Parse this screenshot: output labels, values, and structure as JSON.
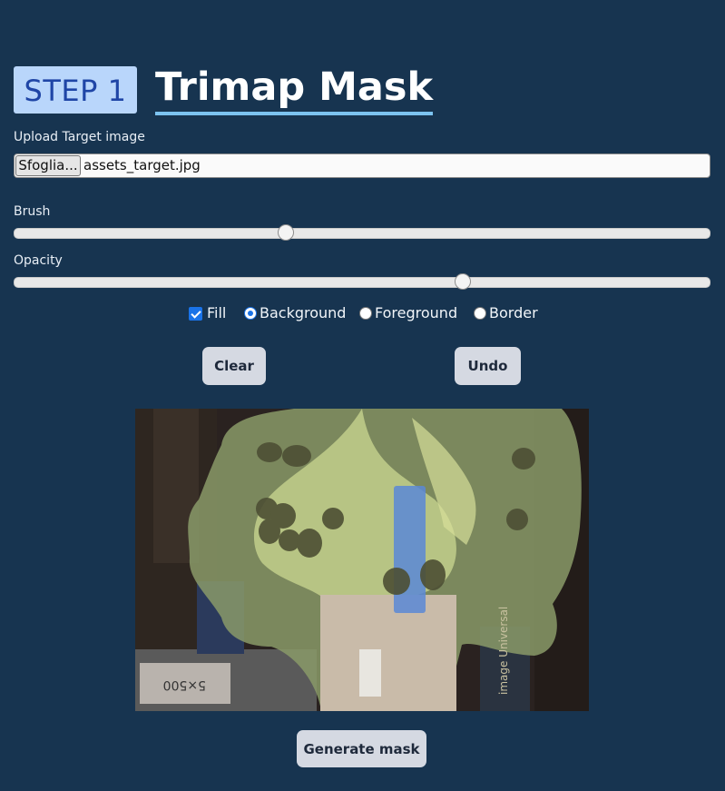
{
  "header": {
    "step_label": "STEP 1",
    "title": "Trimap Mask"
  },
  "upload": {
    "label": "Upload Target image",
    "browse_label": "Sfoglia...",
    "file_name": "assets_target.jpg"
  },
  "brush": {
    "label": "Brush",
    "value_fraction": 0.39
  },
  "opacity": {
    "label": "Opacity",
    "value_fraction": 0.645
  },
  "options": {
    "fill_label": "Fill",
    "fill_checked": true,
    "modes": [
      {
        "label": "Background",
        "checked": true
      },
      {
        "label": "Foreground",
        "checked": false
      },
      {
        "label": "Border",
        "checked": false
      }
    ]
  },
  "actions": {
    "clear_label": "Clear",
    "undo_label": "Undo",
    "generate_label": "Generate mask"
  },
  "canvas": {
    "image_icon": "potted-plant-photo",
    "pot_label_text": "image Universal",
    "box_label_text": "5×500"
  },
  "colors": {
    "page_bg": "#173450",
    "step_badge_bg": "#b9d6fb",
    "step_badge_text": "#1f45a6",
    "title_underline": "#7cc3f0",
    "accent": "#1a73e8",
    "button_bg": "#d5d9e2"
  }
}
